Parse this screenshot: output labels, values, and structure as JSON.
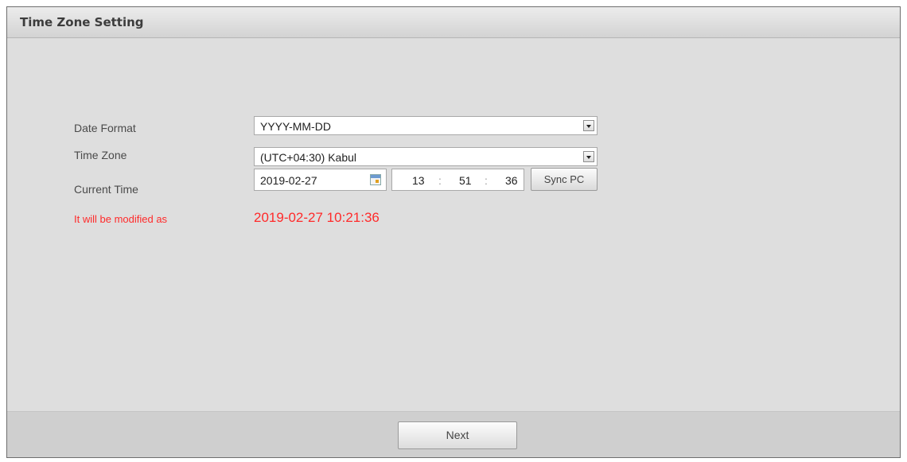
{
  "window": {
    "title": "Time Zone Setting"
  },
  "form": {
    "date_format": {
      "label": "Date Format",
      "value": "YYYY-MM-DD"
    },
    "time_zone": {
      "label": "Time Zone",
      "value": "(UTC+04:30) Kabul"
    },
    "current_time": {
      "label": "Current Time",
      "date": "2019-02-27",
      "hour": "13",
      "minute": "51",
      "second": "36",
      "separator": ":",
      "sync_label": "Sync PC"
    },
    "modified": {
      "label": "It will be modified as",
      "value": "2019-02-27 10:21:36"
    }
  },
  "footer": {
    "next_label": "Next"
  },
  "colors": {
    "warning": "#ff2a2a",
    "panel": "#dedede",
    "footer": "#cfcfcf"
  },
  "icons": {
    "dropdown": "chevron-down-icon",
    "calendar": "calendar-icon"
  }
}
